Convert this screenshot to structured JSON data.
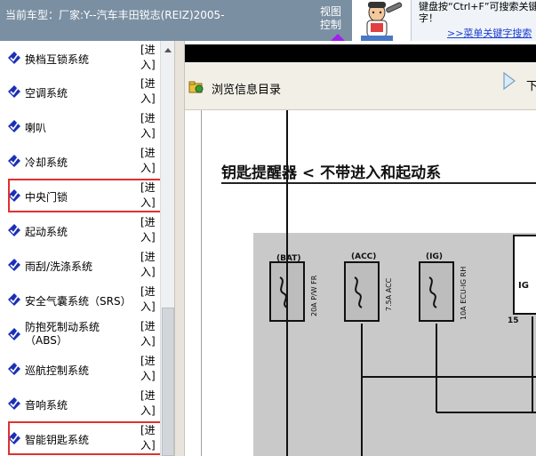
{
  "header": {
    "car_label": "当前车型：厂家:Y--汽车丰田锐志(REIZ)2005-",
    "view_control_label": "视图\n控制",
    "hint_text": "键盘按“Ctrl+F”可搜索关键字！",
    "menu_search_link": ">>菜单关键字搜索"
  },
  "sidebar": {
    "enter_label": "[进\n入]",
    "items": [
      {
        "label": "换档互锁系统"
      },
      {
        "label": "空调系统"
      },
      {
        "label": "喇叭"
      },
      {
        "label": "冷却系统"
      },
      {
        "label": "中央门锁",
        "highlighted": true
      },
      {
        "label": "起动系统"
      },
      {
        "label": "雨刮/洗涤系统"
      },
      {
        "label": "安全气囊系统（SRS）"
      },
      {
        "label": "防抱死制动系统（ABS）"
      },
      {
        "label": "巡航控制系统"
      },
      {
        "label": "音响系统"
      },
      {
        "label": "智能钥匙系统",
        "highlighted": true
      }
    ]
  },
  "toolbar": {
    "browse_label": "浏览信息目录",
    "next_label": "下"
  },
  "document": {
    "title": "钥匙提醒器 < 不带进入和起动系",
    "fuses": [
      {
        "tag": "(BAT)",
        "rating": "20A P/W FR"
      },
      {
        "tag": "(ACC)",
        "rating": "7.5A ACC"
      },
      {
        "tag": "(IG)",
        "rating": "10A ECU-IG RH"
      }
    ],
    "ig_label": "IG",
    "pin_label": "15"
  },
  "colors": {
    "topbar": "#7a8fa2",
    "highlight": "#e03030",
    "link": "#1a3ed0",
    "bullet": "#1a2fb8"
  },
  "icons": {
    "bullet": "blue-diamond-check-icon",
    "browse": "folder-globe-icon",
    "next": "arrow-right-icon",
    "mascot": "mechanic-mascot-icon"
  }
}
